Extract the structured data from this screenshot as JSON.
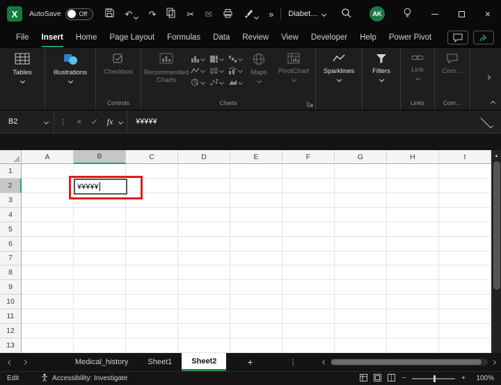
{
  "titlebar": {
    "logo_letter": "X",
    "autosave_label": "AutoSave",
    "autosave_state": "Off",
    "doc_name": "Diabet…",
    "avatar_initials": "AK"
  },
  "ribbon_tabs": {
    "items": [
      "File",
      "Insert",
      "Home",
      "Page Layout",
      "Formulas",
      "Data",
      "Review",
      "View",
      "Developer",
      "Help",
      "Power Pivot"
    ],
    "active": "Insert"
  },
  "ribbon": {
    "tables_label": "Tables",
    "illustrations_label": "Illustrations",
    "checkbox_label": "Checkbox",
    "recommended_charts_label": "Recommended Charts",
    "maps_label": "Maps",
    "pivotchart_label": "PivotChart",
    "sparklines_label": "Sparklines",
    "filters_label": "Filters",
    "link_label": "Link",
    "comment_label": "Com…",
    "group_controls": "Controls",
    "group_charts": "Charts",
    "group_links": "Links",
    "group_comments": "Com…"
  },
  "formula_bar": {
    "name_box": "B2",
    "fx": "fx",
    "formula": "¥¥¥¥¥"
  },
  "grid": {
    "columns": [
      "A",
      "B",
      "C",
      "D",
      "E",
      "F",
      "G",
      "H",
      "I"
    ],
    "rows": [
      "1",
      "2",
      "3",
      "4",
      "5",
      "6",
      "7",
      "8",
      "9",
      "10",
      "11",
      "12",
      "13"
    ],
    "active_col": "B",
    "active_row": "2",
    "active_cell": "B2",
    "cell_value": "¥¥¥¥¥"
  },
  "sheet_bar": {
    "tabs": [
      "Medical_history",
      "Sheet1",
      "Sheet2"
    ],
    "active": "Sheet2"
  },
  "status_bar": {
    "mode": "Edit",
    "accessibility": "Accessibility: Investigate",
    "zoom": "100%"
  },
  "glyphs": {
    "undo": "↶",
    "redo": "↷",
    "cut": "✂",
    "mail": "✉",
    "more": "»",
    "dots": "⋮",
    "cancel": "×",
    "accept": "✓",
    "close": "×",
    "plus": "+",
    "minus": "−",
    "up_arrow": "▲",
    "add_sheet": "+"
  },
  "colors": {
    "accent_green": "#21a366",
    "annotation_red": "#df1c1c",
    "excel_green": "#107c41"
  }
}
